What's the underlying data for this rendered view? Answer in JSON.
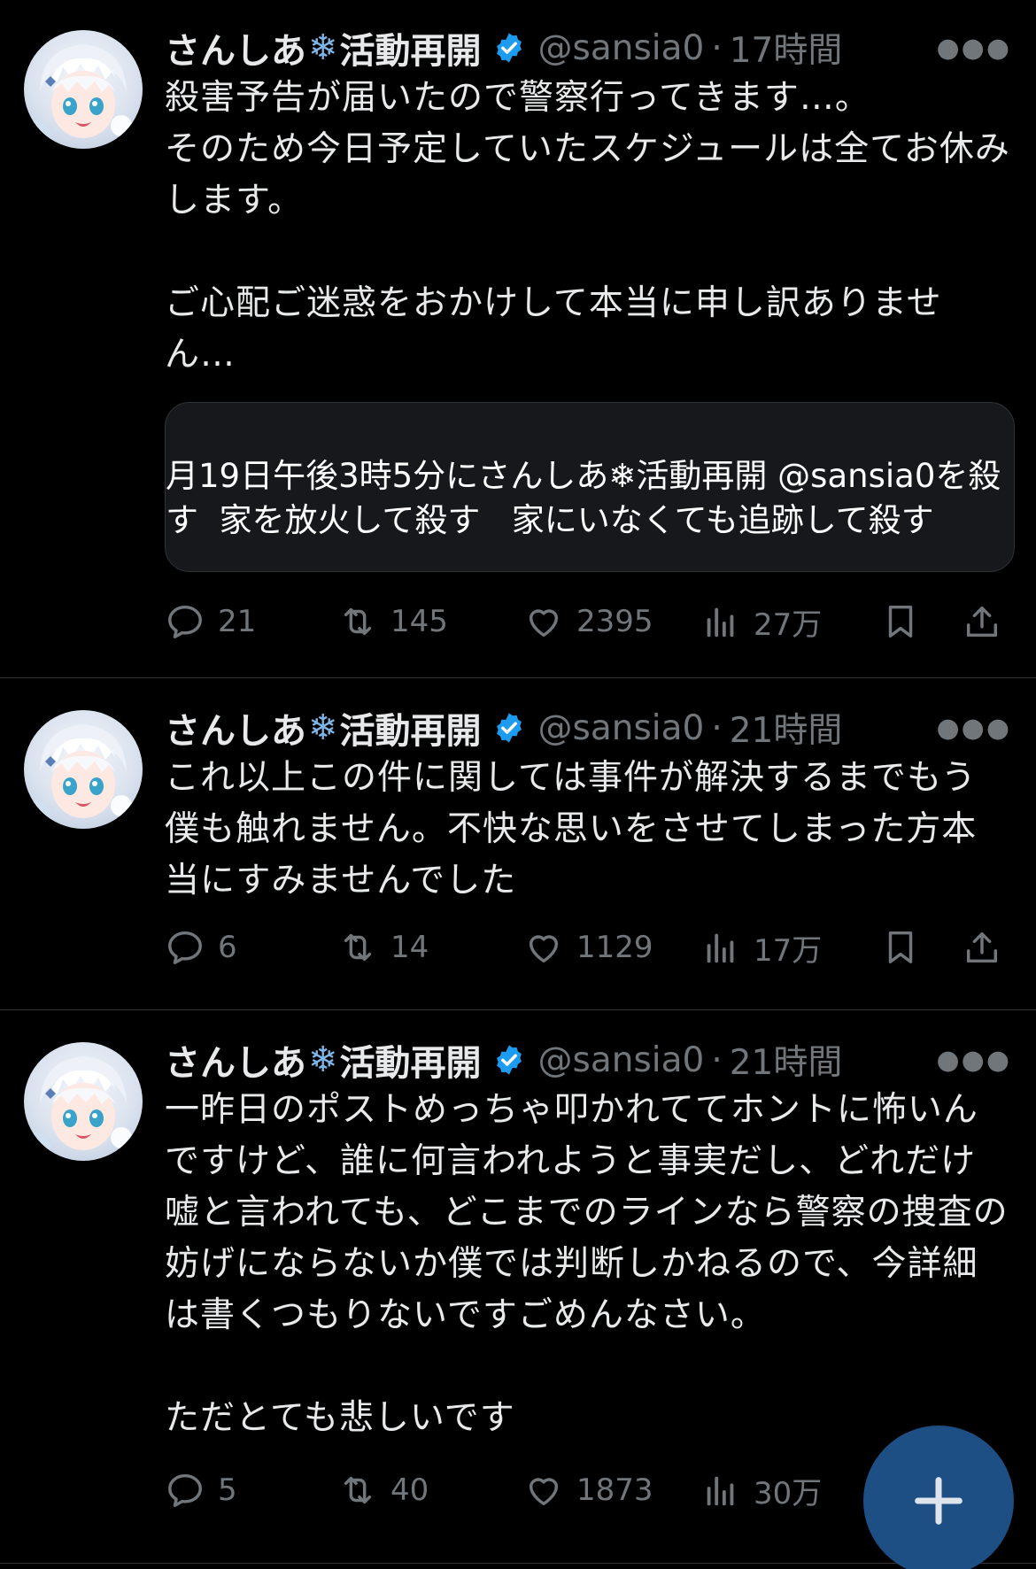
{
  "tweets": [
    {
      "name": "さんしあ",
      "name_suffix": "活動再開",
      "handle": "@sansia0",
      "dot": "·",
      "time": "17時間",
      "text": "殺害予告が届いたので警察行ってきます…。\nそのため今日予定していたスケジュールは全てお休みします。\n\nご心配ご迷惑をおかけして本当に申し訳ありません…",
      "quote_line1": "月19日午後3時5分にさんしあ❄活動再開 @sansia0を殺",
      "quote_line2": "す  家を放火して殺す   家にいなくても追跡して殺す",
      "stats": {
        "replies": "21",
        "reposts": "145",
        "likes": "2395",
        "views": "27万"
      }
    },
    {
      "name": "さんしあ",
      "name_suffix": "活動再開",
      "handle": "@sansia0",
      "dot": "·",
      "time": "21時間",
      "text": "これ以上この件に関しては事件が解決するまでもう僕も触れません。不快な思いをさせてしまった方本当にすみませんでした",
      "stats": {
        "replies": "6",
        "reposts": "14",
        "likes": "1129",
        "views": "17万"
      }
    },
    {
      "name": "さんしあ",
      "name_suffix": "活動再開",
      "handle": "@sansia0",
      "dot": "·",
      "time": "21時間",
      "text": "一昨日のポストめっちゃ叩かれててホントに怖いんですけど、誰に何言われようと事実だし、どれだけ嘘と言われても、どこまでのラインなら警察の捜査の妨げにならないか僕では判断しかねるので、今詳細は書くつもりないですごめんなさい。\n\nただとても悲しいです",
      "stats": {
        "replies": "5",
        "reposts": "40",
        "likes": "1873",
        "views": "30万"
      }
    }
  ],
  "icons": {
    "avatar": "anime-avatar-icon",
    "snowflake": "snowflake-icon",
    "verified": "verified-badge-icon",
    "reply": "reply-icon",
    "repost": "repost-icon",
    "like": "heart-icon",
    "views": "views-icon",
    "bookmark": "bookmark-icon",
    "share": "share-icon",
    "compose": "compose-plus-icon"
  },
  "colors": {
    "background": "#000000",
    "text": "#e7e9ea",
    "muted": "#71767b",
    "accent": "#1d9bf0",
    "fab": "#1d4f85"
  }
}
